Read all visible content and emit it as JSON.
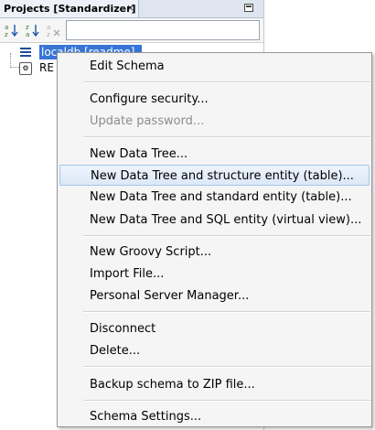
{
  "panel": {
    "tab_title": "Projects [Standardizer]",
    "tab_close": "×",
    "filter_value": ""
  },
  "toolbar": {
    "sort_asc_icon": "sort-ascending-icon",
    "sort_desc_icon": "sort-descending-icon",
    "clear_sort_icon": "clear-sort-icon"
  },
  "tree": {
    "selected_item_label": "localdb [readme]",
    "second_item_label": "RE"
  },
  "menu": {
    "items": [
      {
        "label": "Edit Schema",
        "enabled": true
      },
      {
        "label": "Configure security...",
        "enabled": true
      },
      {
        "label": "Update password...",
        "enabled": false
      },
      {
        "label": "New Data Tree...",
        "enabled": true
      },
      {
        "label": "New Data Tree and structure entity (table)...",
        "enabled": true,
        "hover": true
      },
      {
        "label": "New Data Tree and standard entity (table)...",
        "enabled": true
      },
      {
        "label": "New Data Tree and SQL entity (virtual view)...",
        "enabled": true
      },
      {
        "label": "New Groovy Script...",
        "enabled": true
      },
      {
        "label": "Import File...",
        "enabled": true
      },
      {
        "label": "Personal Server Manager...",
        "enabled": true
      },
      {
        "label": "Disconnect",
        "enabled": true
      },
      {
        "label": "Delete...",
        "enabled": true
      },
      {
        "label": "Backup schema to ZIP file...",
        "enabled": true
      },
      {
        "label": "Schema Settings...",
        "enabled": true
      }
    ]
  },
  "colors": {
    "selection": "#3875d7",
    "menu_background": "#f5f5f5",
    "menu_hover": "#dce8f8"
  }
}
